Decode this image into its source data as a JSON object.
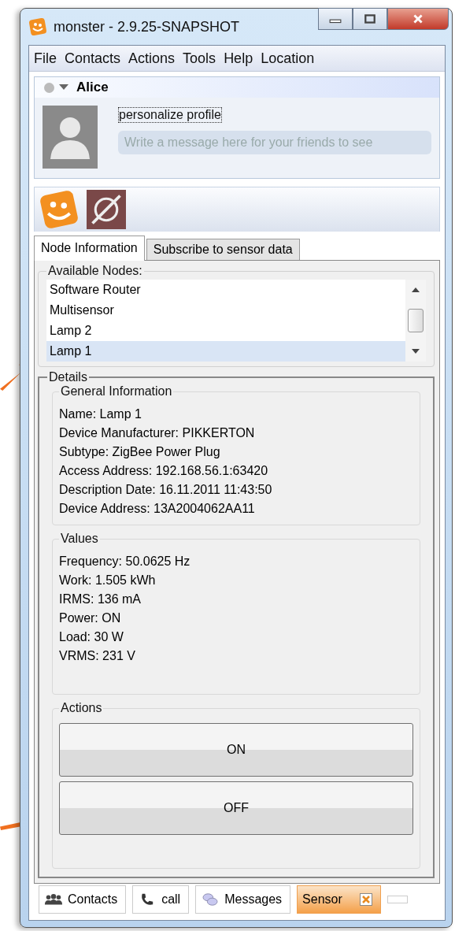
{
  "window": {
    "title": "monster - 2.9.25-SNAPSHOT"
  },
  "menu": [
    "File",
    "Contacts",
    "Actions",
    "Tools",
    "Help",
    "Location"
  ],
  "profile": {
    "name": "Alice",
    "link": "personalize profile",
    "message": {
      "placeholder": "Write a message here for your friends to see"
    }
  },
  "tabs": [
    {
      "label": "Node Information",
      "selected": true
    },
    {
      "label": "Subscribe to sensor data",
      "selected": false
    }
  ],
  "nodes": {
    "title": "Available Nodes:",
    "items": [
      {
        "label": "Software Router",
        "selected": false
      },
      {
        "label": "Multisensor",
        "selected": false
      },
      {
        "label": "Lamp 2",
        "selected": false
      },
      {
        "label": "Lamp 1",
        "selected": true
      }
    ]
  },
  "details": {
    "title": "Details",
    "groups": [
      {
        "title": "General Information",
        "lines": [
          "Name: Lamp 1",
          "Device Manufacturer: PIKKERTON",
          "Subtype: ZigBee Power Plug",
          "Access Address: 192.168.56.1:63420",
          "Description Date: 16.11.2011 11:43:50",
          "Device Address: 13A2004062AA11"
        ]
      },
      {
        "title": "Values",
        "lines": [
          "Frequency: 50.0625 Hz",
          "Work: 1.505 kWh",
          "IRMS: 136 mA",
          "Power: ON",
          "Load: 30 W",
          "VRMS: 231 V"
        ]
      }
    ],
    "actions": {
      "title": "Actions",
      "buttons": [
        "ON",
        "OFF"
      ]
    }
  },
  "bottom_tabs": [
    {
      "kind": "contacts",
      "label": "Contacts",
      "selected": false
    },
    {
      "kind": "call",
      "label": "call",
      "selected": false
    },
    {
      "kind": "messages",
      "label": "Messages",
      "selected": false
    },
    {
      "kind": "sensor",
      "label": "Sensor",
      "selected": true
    }
  ]
}
